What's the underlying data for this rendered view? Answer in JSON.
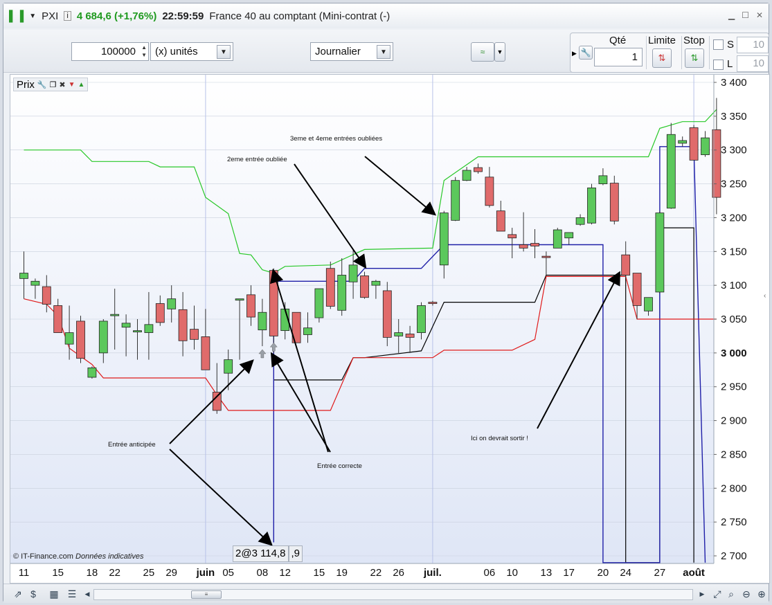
{
  "titlebar": {
    "symbol": "PXI",
    "price_change": "4 684,6 (+1,76%)",
    "time": "22:59:59",
    "instrument": "France 40 au comptant (Mini-contrat  (-)"
  },
  "toolbar": {
    "amount": "100000",
    "unit": "(x) unités",
    "period": "Journalier"
  },
  "order_panel": {
    "qty_label": "Qté",
    "qty_value": "1",
    "limit_label": "Limite",
    "stop_label": "Stop",
    "s_label": "S",
    "l_label": "L",
    "s_value": "10",
    "l_value": "10"
  },
  "chart_panel": {
    "label": "Prix",
    "footer": "© IT-Finance.com",
    "footer_italic": "Données indicatives",
    "position_label": "2@3 114,8",
    "position_suffix": ",9"
  },
  "colors": {
    "up": "#5cc85c",
    "down": "#e06b6b",
    "green_line": "#28c828",
    "red_line": "#e01a1a",
    "blue_line": "#1f1fa8",
    "black_line": "#000000"
  },
  "annotations": [
    "3eme et 4eme entrées oubliées",
    "2eme entrée oubliée",
    "Entrée anticipée",
    "Entrée correcte",
    "Ici on devrait sortir !"
  ],
  "chart_data": {
    "type": "candlestick",
    "ylim": [
      2690,
      3400
    ],
    "y_ticks": [
      2700,
      2750,
      2800,
      2850,
      2900,
      2950,
      3000,
      3050,
      3100,
      3150,
      3200,
      3250,
      3300,
      3350,
      3400
    ],
    "y_tick_labels": [
      "2 700",
      "2 750",
      "2 800",
      "2 850",
      "2 900",
      "2 950",
      "3 000",
      "3 050",
      "3 100",
      "3 150",
      "3 200",
      "3 250",
      "3 300",
      "3 350",
      "3 400"
    ],
    "x_labels": [
      "11",
      "15",
      "18",
      "22",
      "25",
      "29",
      "juin",
      "05",
      "08",
      "12",
      "15",
      "19",
      "22",
      "26",
      "juil.",
      "06",
      "10",
      "13",
      "17",
      "20",
      "24",
      "27",
      "août"
    ],
    "x_label_index": [
      0,
      3,
      6,
      8,
      11,
      13,
      16,
      18,
      21,
      23,
      26,
      28,
      31,
      33,
      36,
      41,
      43,
      46,
      48,
      51,
      53,
      56,
      59
    ],
    "candles": [
      {
        "o": 3110,
        "h": 3150,
        "l": 3080,
        "c": 3118
      },
      {
        "o": 3100,
        "h": 3110,
        "l": 3080,
        "c": 3106
      },
      {
        "o": 3098,
        "h": 3115,
        "l": 3060,
        "c": 3072
      },
      {
        "o": 3070,
        "h": 3080,
        "l": 3030,
        "c": 3030
      },
      {
        "o": 3013,
        "h": 3070,
        "l": 2990,
        "c": 3030
      },
      {
        "o": 3047,
        "h": 3055,
        "l": 2985,
        "c": 2992
      },
      {
        "o": 2964,
        "h": 2980,
        "l": 2962,
        "c": 2978
      },
      {
        "o": 3000,
        "h": 3050,
        "l": 2985,
        "c": 3047
      },
      {
        "o": 3057,
        "h": 3095,
        "l": 3005,
        "c": 3057
      },
      {
        "o": 3038,
        "h": 3057,
        "l": 2995,
        "c": 3044
      },
      {
        "o": 3033,
        "h": 3050,
        "l": 2990,
        "c": 3033
      },
      {
        "o": 3030,
        "h": 3090,
        "l": 2990,
        "c": 3042
      },
      {
        "o": 3073,
        "h": 3085,
        "l": 3040,
        "c": 3045
      },
      {
        "o": 3065,
        "h": 3100,
        "l": 3045,
        "c": 3080
      },
      {
        "o": 3064,
        "h": 3090,
        "l": 2995,
        "c": 3018
      },
      {
        "o": 3035,
        "h": 3070,
        "l": 3005,
        "c": 3020
      },
      {
        "o": 3024,
        "h": 3065,
        "l": 2998,
        "c": 2975
      },
      {
        "o": 2942,
        "h": 2985,
        "l": 2910,
        "c": 2915
      },
      {
        "o": 2970,
        "h": 3005,
        "l": 2945,
        "c": 2990
      },
      {
        "o": 3080,
        "h": 3080,
        "l": 2990,
        "c": 3080
      },
      {
        "o": 3086,
        "h": 3100,
        "l": 3040,
        "c": 3053
      },
      {
        "o": 3034,
        "h": 3080,
        "l": 3010,
        "c": 3060
      },
      {
        "o": 3122,
        "h": 3125,
        "l": 3000,
        "c": 3025
      },
      {
        "o": 3033,
        "h": 3075,
        "l": 3020,
        "c": 3065
      },
      {
        "o": 3060,
        "h": 3060,
        "l": 3015,
        "c": 3015
      },
      {
        "o": 3027,
        "h": 3060,
        "l": 3015,
        "c": 3037
      },
      {
        "o": 3052,
        "h": 3095,
        "l": 3045,
        "c": 3095
      },
      {
        "o": 3125,
        "h": 3135,
        "l": 3065,
        "c": 3069
      },
      {
        "o": 3063,
        "h": 3140,
        "l": 3055,
        "c": 3115
      },
      {
        "o": 3105,
        "h": 3152,
        "l": 3080,
        "c": 3130
      },
      {
        "o": 3114,
        "h": 3120,
        "l": 3080,
        "c": 3082
      },
      {
        "o": 3100,
        "h": 3108,
        "l": 3080,
        "c": 3106
      },
      {
        "o": 3092,
        "h": 3105,
        "l": 3010,
        "c": 3023
      },
      {
        "o": 3025,
        "h": 3050,
        "l": 3000,
        "c": 3030
      },
      {
        "o": 3028,
        "h": 3040,
        "l": 3000,
        "c": 3023
      },
      {
        "o": 3030,
        "h": 3075,
        "l": 3020,
        "c": 3070
      },
      {
        "o": 3075,
        "h": 3077,
        "l": 3070,
        "c": 3073
      },
      {
        "o": 3130,
        "h": 3210,
        "l": 3110,
        "c": 3207
      },
      {
        "o": 3196,
        "h": 3260,
        "l": 3195,
        "c": 3255
      },
      {
        "o": 3255,
        "h": 3275,
        "l": 3254,
        "c": 3270
      },
      {
        "o": 3274,
        "h": 3280,
        "l": 3265,
        "c": 3268
      },
      {
        "o": 3260,
        "h": 3275,
        "l": 3215,
        "c": 3218
      },
      {
        "o": 3210,
        "h": 3225,
        "l": 3180,
        "c": 3180
      },
      {
        "o": 3175,
        "h": 3185,
        "l": 3140,
        "c": 3170
      },
      {
        "o": 3160,
        "h": 3208,
        "l": 3150,
        "c": 3155
      },
      {
        "o": 3162,
        "h": 3183,
        "l": 3140,
        "c": 3158
      },
      {
        "o": 3143,
        "h": 3150,
        "l": 3115,
        "c": 3141
      },
      {
        "o": 3155,
        "h": 3185,
        "l": 3155,
        "c": 3182
      },
      {
        "o": 3170,
        "h": 3178,
        "l": 3160,
        "c": 3178
      },
      {
        "o": 3190,
        "h": 3205,
        "l": 3188,
        "c": 3200
      },
      {
        "o": 3192,
        "h": 3250,
        "l": 3190,
        "c": 3244
      },
      {
        "o": 3250,
        "h": 3273,
        "l": 3248,
        "c": 3262
      },
      {
        "o": 3251,
        "h": 3262,
        "l": 3190,
        "c": 3195
      },
      {
        "o": 3145,
        "h": 3165,
        "l": 3110,
        "c": 3115
      },
      {
        "o": 3118,
        "h": 3118,
        "l": 3050,
        "c": 3070
      },
      {
        "o": 3062,
        "h": 3082,
        "l": 3055,
        "c": 3082
      },
      {
        "o": 3090,
        "h": 3210,
        "l": 3088,
        "c": 3207
      },
      {
        "o": 3214,
        "h": 3340,
        "l": 3213,
        "c": 3323
      },
      {
        "o": 3310,
        "h": 3320,
        "l": 3305,
        "c": 3314
      },
      {
        "o": 3333,
        "h": 3337,
        "l": 3285,
        "c": 3285
      },
      {
        "o": 3293,
        "h": 3328,
        "l": 3290,
        "c": 3318
      },
      {
        "o": 3330,
        "h": 3377,
        "l": 3205,
        "c": 3230
      }
    ],
    "green_line": [
      [
        0,
        3300
      ],
      [
        5,
        3300
      ],
      [
        6,
        3283
      ],
      [
        11,
        3283
      ],
      [
        12,
        3275
      ],
      [
        15,
        3275
      ],
      [
        16,
        3230
      ],
      [
        18,
        3206
      ],
      [
        19,
        3147
      ],
      [
        20,
        3145
      ],
      [
        21,
        3123
      ],
      [
        22,
        3118
      ],
      [
        23,
        3128
      ],
      [
        27,
        3130
      ],
      [
        30,
        3153
      ],
      [
        36,
        3155
      ],
      [
        37,
        3255
      ],
      [
        40,
        3290
      ],
      [
        41,
        3290
      ],
      [
        42,
        3290
      ],
      [
        55,
        3290
      ],
      [
        56,
        3332
      ],
      [
        58,
        3342
      ],
      [
        60,
        3342
      ],
      [
        61,
        3360
      ]
    ],
    "red_line": [
      [
        0,
        3080
      ],
      [
        2,
        3072
      ],
      [
        3,
        3055
      ],
      [
        4,
        3007
      ],
      [
        6,
        2983
      ],
      [
        7,
        2963
      ],
      [
        16,
        2963
      ],
      [
        17,
        2938
      ],
      [
        18,
        2915
      ],
      [
        27,
        2915
      ],
      [
        29,
        2993
      ],
      [
        36,
        2993
      ],
      [
        37,
        3004
      ],
      [
        43,
        3004
      ],
      [
        45,
        3020
      ],
      [
        46,
        3113
      ],
      [
        52,
        3113
      ],
      [
        53,
        3113
      ],
      [
        54,
        3050
      ],
      [
        61,
        3050
      ]
    ],
    "blue_line": [
      [
        22,
        2720
      ],
      [
        22,
        3106
      ],
      [
        29,
        3106
      ],
      [
        30,
        3125
      ],
      [
        35,
        3125
      ],
      [
        37,
        3160
      ],
      [
        51,
        3160
      ],
      [
        51,
        2690
      ],
      [
        56,
        2690
      ],
      [
        56,
        3305
      ],
      [
        59,
        3305
      ],
      [
        60,
        2690
      ]
    ],
    "black_line": [
      [
        22,
        2960
      ],
      [
        28,
        2960
      ],
      [
        29,
        2993
      ],
      [
        30,
        2993
      ],
      [
        35,
        3003
      ],
      [
        37,
        3075
      ],
      [
        45,
        3075
      ],
      [
        46,
        3115
      ],
      [
        53,
        3115
      ],
      [
        53,
        2690
      ],
      [
        56,
        2690
      ],
      [
        56,
        3185
      ],
      [
        59,
        3185
      ],
      [
        59,
        2690
      ]
    ],
    "last_close": 3000
  }
}
